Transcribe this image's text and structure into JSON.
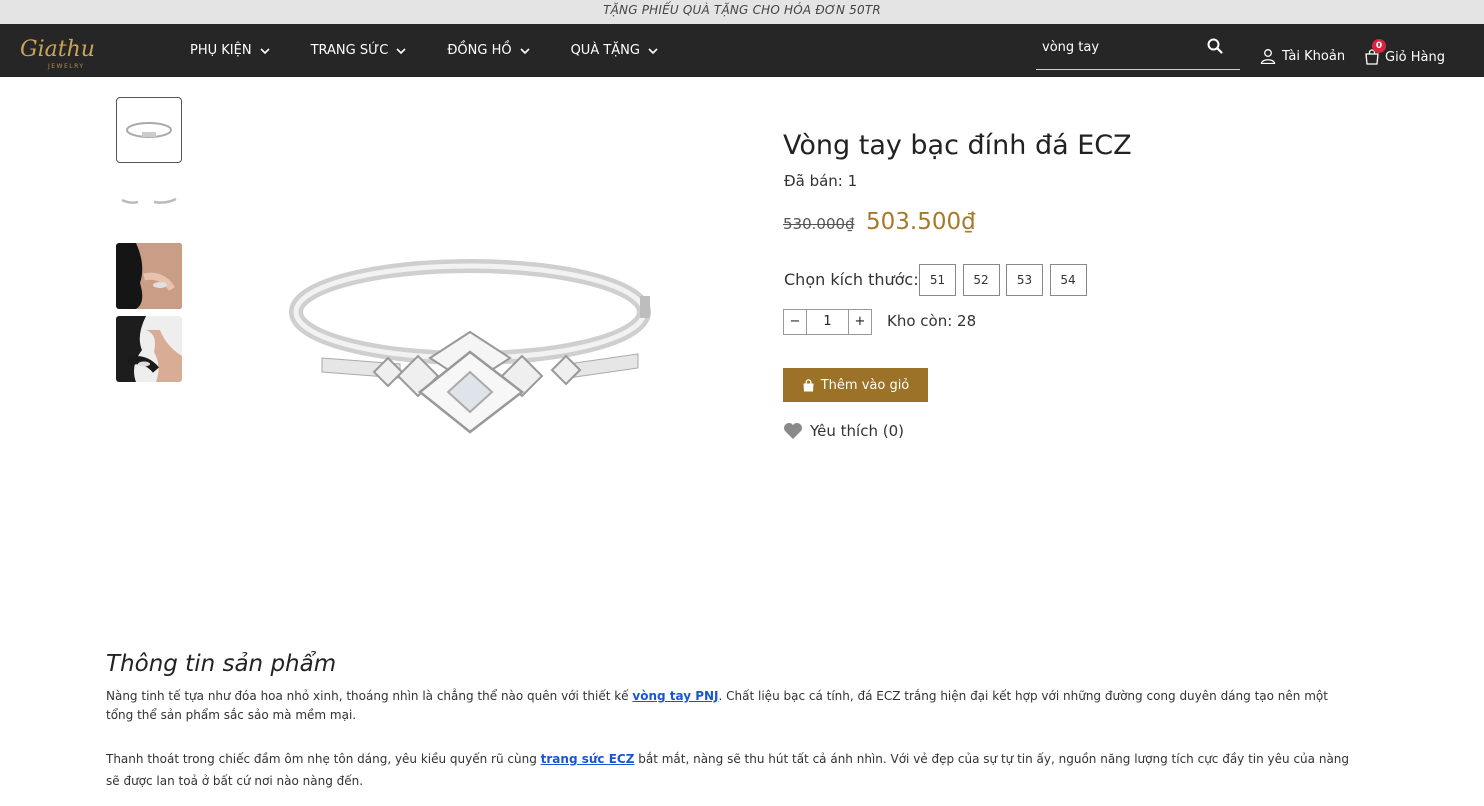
{
  "promo": {
    "text": "TẶNG PHIẾU QUÀ TẶNG CHO HÓA ĐƠN 50TR"
  },
  "header": {
    "logo_text": "Giathu",
    "logo_sub": "JEWELRY",
    "menu": [
      {
        "label": "PHỤ KIỆN"
      },
      {
        "label": "TRANG SỨC"
      },
      {
        "label": "ĐỒNG HỒ"
      },
      {
        "label": "QUÀ TẶNG"
      }
    ],
    "search_value": "vòng tay",
    "account_label": "Tài Khoản",
    "cart_label": "Giỏ Hàng",
    "cart_count": "0"
  },
  "product": {
    "title": "Vòng tay bạc đính đá ECZ",
    "sold": "Đã bán: 1",
    "old_price": "530.000₫",
    "new_price": "503.500₫",
    "size_label": "Chọn kích thước:",
    "sizes": [
      "51",
      "52",
      "53",
      "54"
    ],
    "qty_minus": "−",
    "qty_value": "1",
    "qty_plus": "+",
    "stock": "Kho còn: 28",
    "add_to_cart": "Thêm vào giỏ",
    "wishlist": "Yêu thích (0)"
  },
  "description": {
    "title": "Thông tin sản phẩm",
    "p1_before": "Nàng tinh tế tựa như đóa hoa nhỏ xinh, thoáng nhìn là chẳng thể nào quên với thiết kế ",
    "p1_link": "vòng tay PNJ",
    "p1_after": ". Chất liệu bạc cá tính, đá ECZ trắng hiện đại kết hợp với những đường cong duyên dáng tạo nên một",
    "p1_line2": "tổng thể sản phẩm sắc sảo mà mềm mại.",
    "p2_before": "Thanh thoát trong chiếc đầm ôm nhẹ tôn dáng, yêu kiều quyến rũ cùng ",
    "p2_link": "trang sức ECZ",
    "p2_after": " bắt mắt, nàng sẽ thu hút tất cả ánh nhìn. Với vẻ đẹp của sự tự tin ấy, nguồn năng lượng tích cực đầy tin yêu của nàng",
    "p2_line2": "sẽ được lan toả ở bất cứ nơi nào nàng đến."
  },
  "colors": {
    "nav_bg": "#262626",
    "accent": "#a57a2b",
    "button": "#9c7228",
    "link": "#1a55d6",
    "badge": "#d7263d"
  }
}
